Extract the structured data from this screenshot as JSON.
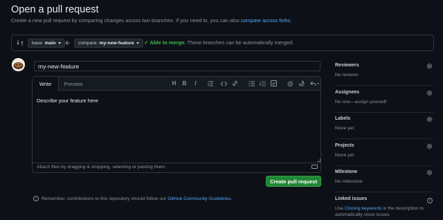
{
  "header": {
    "title": "Open a pull request",
    "subtitle_prefix": "Create a new pull request by comparing changes across two branches. If you need to, you can also ",
    "subtitle_link": "compare across forks",
    "subtitle_suffix": "."
  },
  "compare": {
    "base_label": "base:",
    "base_branch": "main",
    "compare_label": "compare:",
    "compare_branch": "my-new-feature",
    "merge_status": "Able to merge.",
    "merge_detail": "These branches can be automatically merged."
  },
  "form": {
    "title_value": "my-new-feature",
    "tabs": [
      "Write",
      "Preview"
    ],
    "body_text": "Describe your feature here",
    "attach_hint": "Attach files by dragging & dropping, selecting or pasting them.",
    "submit_label": "Create pull request"
  },
  "toolbar": {
    "icons": [
      "heading-icon",
      "bold-icon",
      "italic-icon",
      "quote-icon",
      "code-icon",
      "link-icon",
      "unordered-list-icon",
      "ordered-list-icon",
      "task-list-icon",
      "mention-icon",
      "reference-icon",
      "reply-icon"
    ]
  },
  "footer": {
    "remember_prefix": "Remember, contributions to this repository should follow our ",
    "remember_link": "GitHub Community Guidelines",
    "remember_suffix": "."
  },
  "sidebar": {
    "reviewers": {
      "title": "Reviewers",
      "value": "No reviews"
    },
    "assignees": {
      "title": "Assignees",
      "value": "No one—assign yourself"
    },
    "labels": {
      "title": "Labels",
      "value": "None yet"
    },
    "projects": {
      "title": "Projects",
      "value": "None yet"
    },
    "milestone": {
      "title": "Milestone",
      "value": "No milestone"
    },
    "linked": {
      "title": "Linked issues",
      "value_prefix": "Use ",
      "value_link": "Closing keywords",
      "value_suffix_1": " in the description to",
      "value_suffix_2": "automatically close issues"
    }
  },
  "colors": {
    "background": "#0d1117",
    "accent": "#58a6ff",
    "success": "#3fb950",
    "button_green": "#238636"
  }
}
